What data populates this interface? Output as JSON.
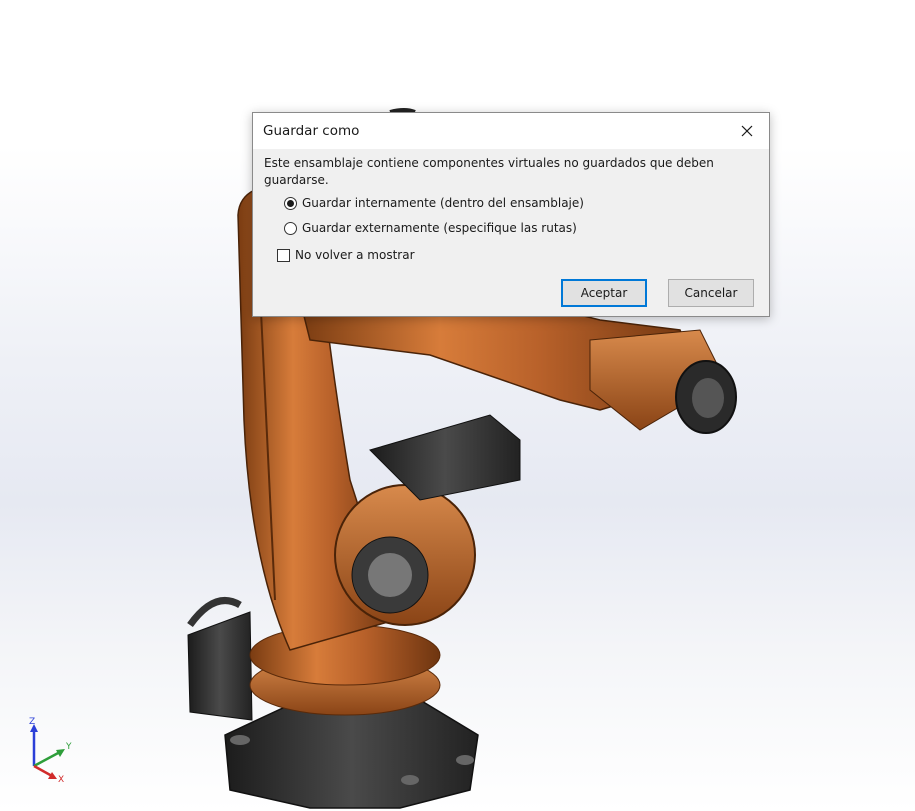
{
  "dialog": {
    "title": "Guardar como",
    "message": "Este ensamblaje contiene componentes virtuales no guardados que deben guardarse.",
    "options": [
      {
        "label": "Guardar internamente (dentro del ensamblaje)",
        "selected": true
      },
      {
        "label": "Guardar externamente (especifique las rutas)",
        "selected": false
      }
    ],
    "checkbox": {
      "label": "No volver a mostrar",
      "checked": false
    },
    "ok_label": "Aceptar",
    "cancel_label": "Cancelar"
  },
  "triad": {
    "z": "Z",
    "y": "Y",
    "x": "X"
  },
  "colors": {
    "robot_orange": "#c06a2c",
    "robot_dark": "#2e2e2e",
    "accent_blue": "#0078d7"
  }
}
